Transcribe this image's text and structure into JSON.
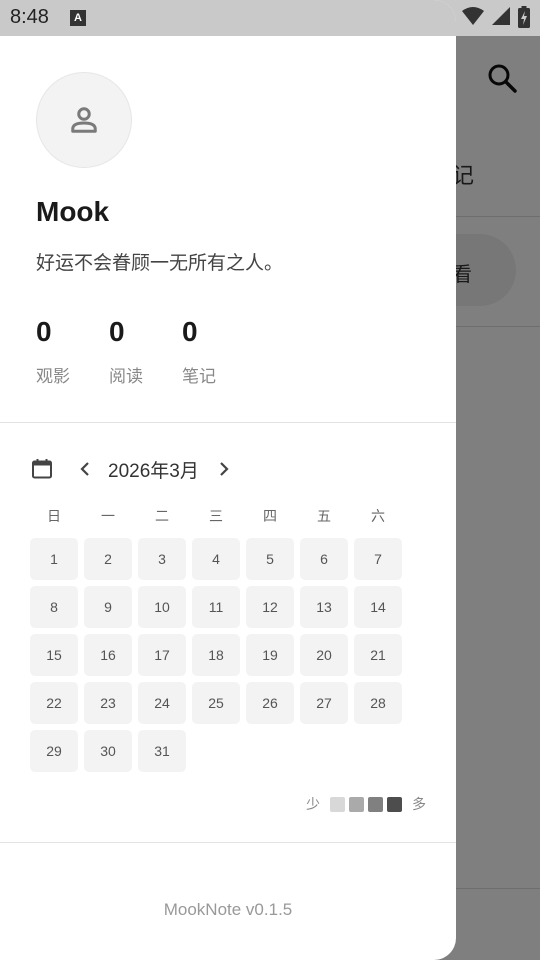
{
  "status_bar": {
    "time": "8:48",
    "notification_icon_letter": "A"
  },
  "background": {
    "tab_partial_text": "记",
    "pill_partial_text": "看"
  },
  "drawer": {
    "profile": {
      "name": "Mook",
      "motto": "好运不会眷顾一无所有之人。",
      "avatar_icon": "person-icon"
    },
    "stats": [
      {
        "value": "0",
        "label": "观影"
      },
      {
        "value": "0",
        "label": "阅读"
      },
      {
        "value": "0",
        "label": "笔记"
      }
    ],
    "calendar": {
      "month_label": "2026年3月",
      "weekdays": [
        "日",
        "一",
        "二",
        "三",
        "四",
        "五",
        "六"
      ],
      "days": [
        "1",
        "2",
        "3",
        "4",
        "5",
        "6",
        "7",
        "8",
        "9",
        "10",
        "11",
        "12",
        "13",
        "14",
        "15",
        "16",
        "17",
        "18",
        "19",
        "20",
        "21",
        "22",
        "23",
        "24",
        "25",
        "26",
        "27",
        "28",
        "29",
        "30",
        "31"
      ],
      "legend_less": "少",
      "legend_more": "多",
      "legend_colors": [
        "#d8d8d8",
        "#aaaaaa",
        "#808080",
        "#4d4d4d"
      ]
    },
    "version": "MookNote v0.1.5"
  }
}
